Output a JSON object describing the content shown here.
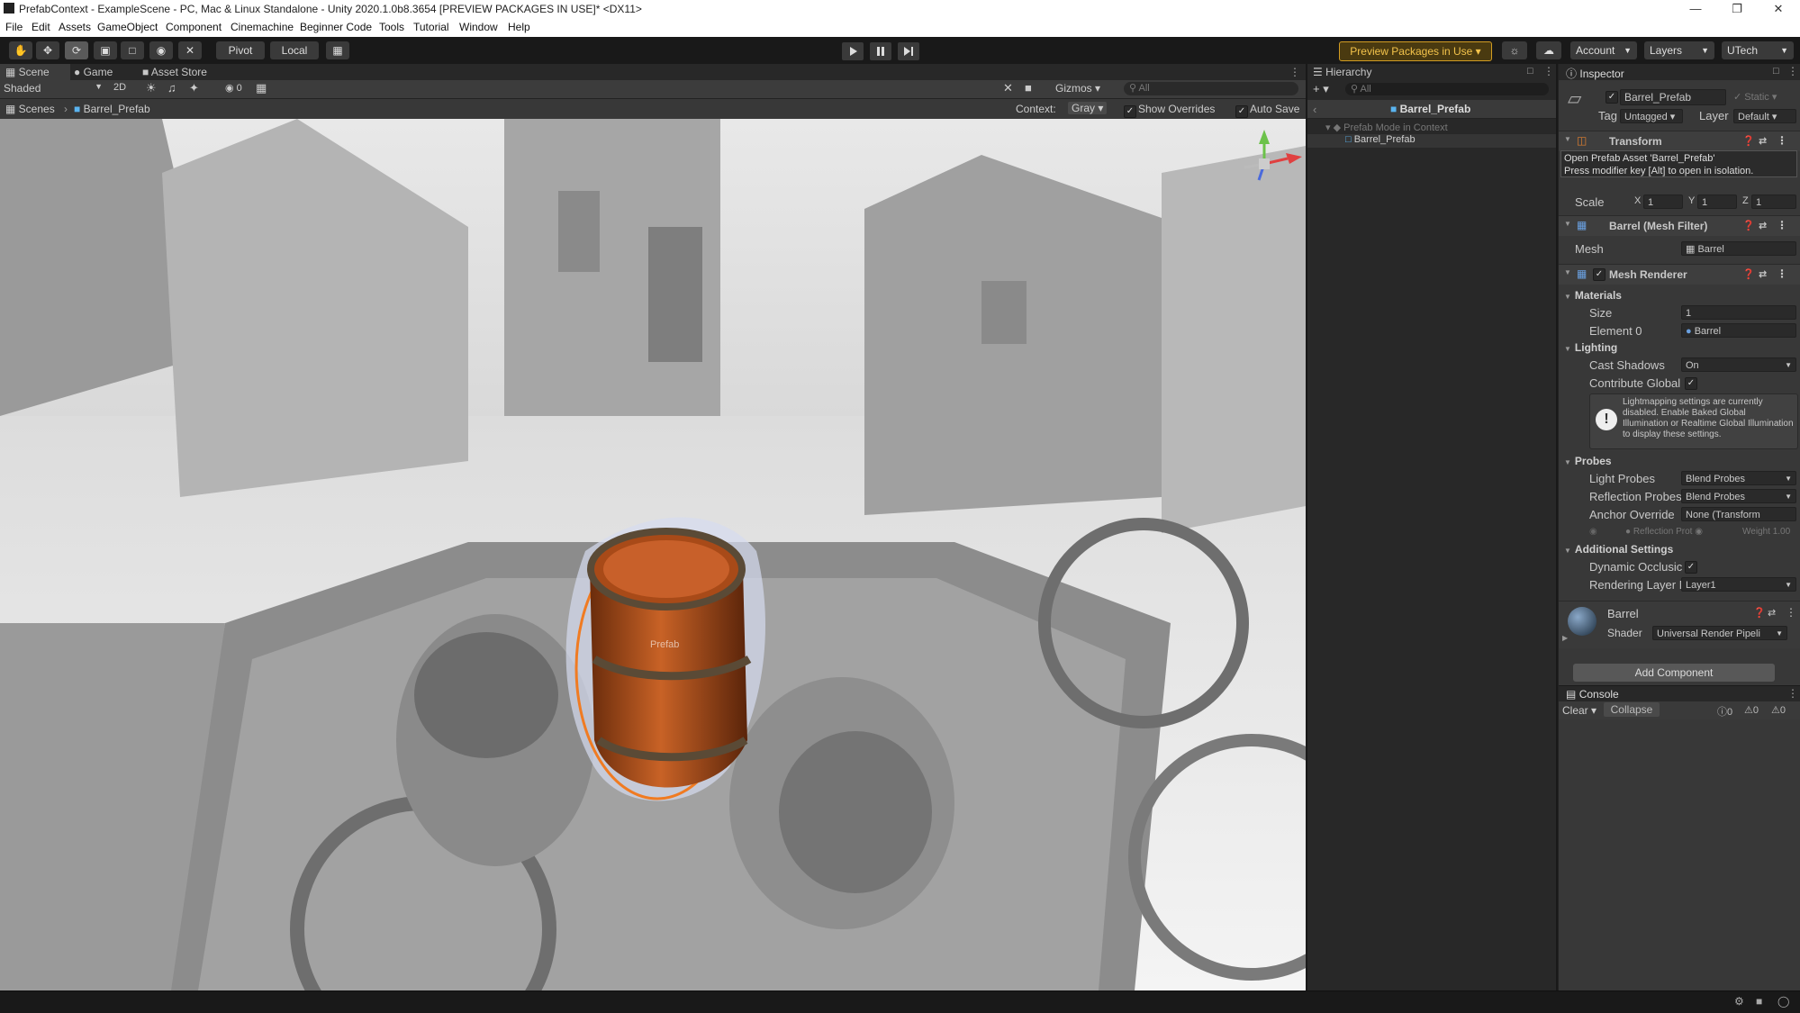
{
  "window": {
    "title": "PrefabContext - ExampleScene - PC, Mac & Linux Standalone - Unity 2020.1.0b8.3654 [PREVIEW PACKAGES IN USE]* <DX11>"
  },
  "menu": [
    "File",
    "Edit",
    "Assets",
    "GameObject",
    "Component",
    "Cinemachine",
    "Beginner Code",
    "Tools",
    "Tutorial",
    "Window",
    "Help"
  ],
  "toolbar": {
    "pivot": "Pivot",
    "local": "Local",
    "preview_packages": "Preview Packages in Use",
    "account": "Account",
    "layers": "Layers",
    "layout": "UTech"
  },
  "scene": {
    "tabs": [
      "Scene",
      "Game",
      "Asset Store"
    ],
    "shading": "Shaded",
    "mode_2d": "2D",
    "hidden_count": "0",
    "gizmos": "Gizmos",
    "search_placeholder": "All",
    "breadcrumb": [
      "Scenes",
      "Barrel_Prefab"
    ],
    "context_label": "Context:",
    "context_value": "Gray",
    "show_overrides": "Show Overrides",
    "auto_save": "Auto Save",
    "prefab_label": "Prefab"
  },
  "hierarchy": {
    "title": "Hierarchy",
    "search_placeholder": "All",
    "header": "Barrel_Prefab",
    "items": [
      {
        "label": "Prefab Mode in Context",
        "dim": true
      },
      {
        "label": "Barrel_Prefab",
        "dim": false
      }
    ]
  },
  "inspector": {
    "title": "Inspector",
    "object_name": "Barrel_Prefab",
    "static_label": "Static",
    "tag_label": "Tag",
    "tag_value": "Untagged",
    "layer_label": "Layer",
    "layer_value": "Default",
    "transform": {
      "title": "Transform",
      "tooltip_line1": "Open Prefab Asset 'Barrel_Prefab'",
      "tooltip_line2": "Press modifier key [Alt] to open in isolation.",
      "scale_label": "Scale",
      "x_label": "X",
      "x": "1",
      "y_label": "Y",
      "y": "1",
      "z_label": "Z",
      "z": "1"
    },
    "mesh_filter": {
      "title": "Barrel (Mesh Filter)",
      "mesh_label": "Mesh",
      "mesh_value": "Barrel"
    },
    "mesh_renderer": {
      "title": "Mesh Renderer",
      "materials": "Materials",
      "size_label": "Size",
      "size_value": "1",
      "element0_label": "Element 0",
      "element0_value": "Barrel",
      "lighting": "Lighting",
      "cast_shadows_label": "Cast Shadows",
      "cast_shadows_value": "On",
      "contribute_global_label": "Contribute Global",
      "info": "Lightmapping settings are currently disabled. Enable Baked Global Illumination or Realtime Global Illumination to display these settings.",
      "probes": "Probes",
      "light_probes_label": "Light Probes",
      "light_probes_value": "Blend Probes",
      "reflection_probes_label": "Reflection Probes",
      "reflection_probes_value": "Blend Probes",
      "anchor_override_label": "Anchor Override",
      "anchor_override_value": "None (Transform",
      "refl_prob_sub": "Reflection Prot",
      "weight_sub": "Weight 1.00",
      "additional": "Additional Settings",
      "dynamic_occlusion_label": "Dynamic Occlusic",
      "rendering_layer_label": "Rendering Layer M",
      "rendering_layer_value": "Layer1"
    },
    "material": {
      "name": "Barrel",
      "shader_label": "Shader",
      "shader_value": "Universal Render Pipeli"
    },
    "add_component": "Add Component"
  },
  "console": {
    "title": "Console",
    "clear": "Clear",
    "collapse": "Collapse",
    "info_count": "0",
    "warn_count": "0",
    "error_count": "0"
  },
  "colors": {
    "accent": "#d29c22",
    "selection_outline": "#f07b22",
    "barrel_wood": "#b8531c",
    "panel_bg": "#383838"
  }
}
